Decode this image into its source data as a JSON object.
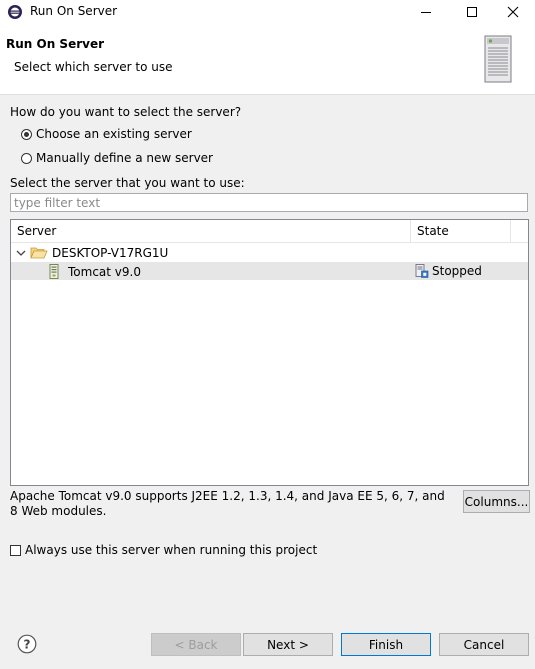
{
  "window": {
    "title": "Run On Server"
  },
  "header": {
    "title": "Run On Server",
    "subtitle": "Select which server to use"
  },
  "selection": {
    "question": "How do you want to select the server?",
    "option_existing": "Choose an existing server",
    "option_manual": "Manually define a new server",
    "selected": "existing"
  },
  "server_list": {
    "label": "Select the server that you want to use:",
    "filter_placeholder": "type filter text",
    "columns": [
      "Server",
      "State"
    ],
    "host": "DESKTOP-V17RG1U",
    "servers": [
      {
        "name": "Tomcat v9.0",
        "state": "Stopped",
        "selected": true
      }
    ]
  },
  "description": "Apache Tomcat v9.0 supports J2EE 1.2, 1.3, 1.4, and Java EE 5, 6, 7, and 8 Web modules.",
  "columns_button": "Columns...",
  "always_use_label": "Always use this server when running this project",
  "buttons": {
    "back": "< Back",
    "next": "Next >",
    "finish": "Finish",
    "cancel": "Cancel"
  },
  "colors": {
    "accent": "#0078d7",
    "selected_row": "#e6e6e6",
    "folder": "#e8b84a"
  },
  "icons": {
    "app": "eclipse-icon",
    "banner": "server-rack-icon",
    "host": "folder-open-icon",
    "server": "tomcat-server-icon",
    "state": "server-stopped-icon",
    "help": "help-icon"
  }
}
